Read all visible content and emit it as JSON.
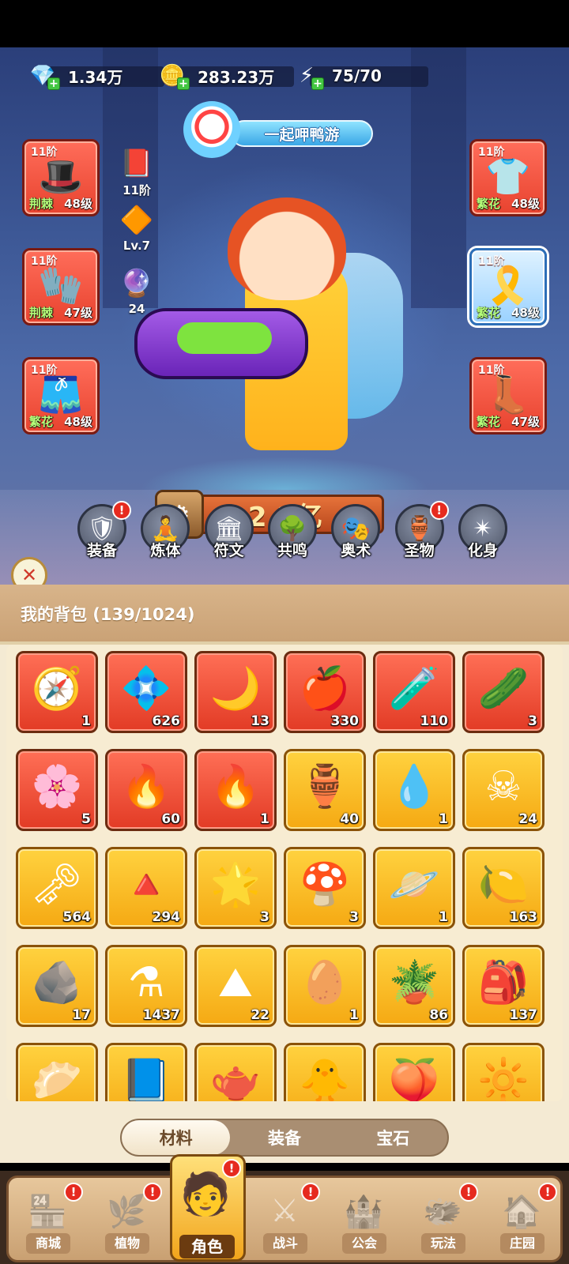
{
  "resources": [
    {
      "icon": "💎",
      "value": "1.34万",
      "name": "diamond"
    },
    {
      "icon": "🪙",
      "value": "283.23万",
      "name": "gold-coin"
    },
    {
      "icon": "⚡",
      "value": "75/70",
      "name": "stamina"
    }
  ],
  "event_banner": {
    "label": "一起呷鸭游"
  },
  "equipment_left": [
    {
      "tier": "11阶",
      "set": "荆棘",
      "level": "48级",
      "icon": "🎩"
    },
    {
      "tier": "11阶",
      "set": "荆棘",
      "level": "47级",
      "icon": "🧤"
    },
    {
      "tier": "11阶",
      "set": "繁花",
      "level": "48级",
      "icon": "🩳"
    }
  ],
  "equipment_right": [
    {
      "tier": "11阶",
      "set": "繁花",
      "level": "48级",
      "icon": "👕"
    },
    {
      "tier": "11阶",
      "set": "繁花",
      "level": "48级",
      "icon": "🎗️"
    },
    {
      "tier": "11阶",
      "set": "繁花",
      "level": "47级",
      "icon": "👢"
    }
  ],
  "mini_stats": [
    {
      "icon": "📕",
      "text": "11阶"
    },
    {
      "icon": "🔶",
      "text": "Lv.7"
    },
    {
      "icon": "🔮",
      "text": "24"
    }
  ],
  "power": {
    "value": "2.2亿",
    "help": "?"
  },
  "functions": [
    {
      "label": "装备",
      "icon": "🛡",
      "alert": "!"
    },
    {
      "label": "炼体",
      "icon": "🧘",
      "alert": ""
    },
    {
      "label": "符文",
      "icon": "🏛",
      "alert": ""
    },
    {
      "label": "共鸣",
      "icon": "🌳",
      "alert": ""
    },
    {
      "label": "奥术",
      "icon": "🎭",
      "alert": ""
    },
    {
      "label": "圣物",
      "icon": "🏺",
      "alert": "!"
    },
    {
      "label": "化身",
      "icon": "✴",
      "alert": ""
    }
  ],
  "bag": {
    "title": "我的背包 (139/1024)",
    "items": [
      {
        "icon": "🧭",
        "qty": "1",
        "rarity": "red"
      },
      {
        "icon": "💠",
        "qty": "626",
        "rarity": "red"
      },
      {
        "icon": "🌙",
        "qty": "13",
        "rarity": "red"
      },
      {
        "icon": "🍎",
        "qty": "330",
        "rarity": "red"
      },
      {
        "icon": "🧪",
        "qty": "110",
        "rarity": "red"
      },
      {
        "icon": "🥒",
        "qty": "3",
        "rarity": "red"
      },
      {
        "icon": "🌸",
        "qty": "5",
        "rarity": "red"
      },
      {
        "icon": "🔥",
        "qty": "60",
        "rarity": "red"
      },
      {
        "icon": "🔥",
        "qty": "1",
        "rarity": "red"
      },
      {
        "icon": "🏺",
        "qty": "40",
        "rarity": "gold"
      },
      {
        "icon": "💧",
        "qty": "1",
        "rarity": "gold"
      },
      {
        "icon": "☠",
        "qty": "24",
        "rarity": "gold"
      },
      {
        "icon": "🗝",
        "qty": "564",
        "rarity": "gold"
      },
      {
        "icon": "🔺",
        "qty": "294",
        "rarity": "gold"
      },
      {
        "icon": "🌟",
        "qty": "3",
        "rarity": "gold"
      },
      {
        "icon": "🍄",
        "qty": "3",
        "rarity": "gold"
      },
      {
        "icon": "🪐",
        "qty": "1",
        "rarity": "gold"
      },
      {
        "icon": "🍋",
        "qty": "163",
        "rarity": "gold"
      },
      {
        "icon": "🪨",
        "qty": "17",
        "rarity": "gold"
      },
      {
        "icon": "⚗",
        "qty": "1437",
        "rarity": "gold"
      },
      {
        "icon": "⛰",
        "qty": "22",
        "rarity": "gold"
      },
      {
        "icon": "🥚",
        "qty": "1",
        "rarity": "gold"
      },
      {
        "icon": "🪴",
        "qty": "86",
        "rarity": "gold"
      },
      {
        "icon": "🎒",
        "qty": "137",
        "rarity": "gold"
      },
      {
        "icon": "🥟",
        "qty": "",
        "rarity": "gold"
      },
      {
        "icon": "📘",
        "qty": "",
        "rarity": "gold"
      },
      {
        "icon": "🫖",
        "qty": "",
        "rarity": "gold"
      },
      {
        "icon": "🐥",
        "qty": "",
        "rarity": "gold"
      },
      {
        "icon": "🍑",
        "qty": "",
        "rarity": "gold"
      },
      {
        "icon": "🔆",
        "qty": "",
        "rarity": "gold"
      }
    ]
  },
  "bag_tabs": [
    {
      "label": "材料",
      "active": true
    },
    {
      "label": "装备",
      "active": false
    },
    {
      "label": "宝石",
      "active": false
    }
  ],
  "nav": [
    {
      "label": "商城",
      "icon": "🏪",
      "alert": "!",
      "active": false
    },
    {
      "label": "植物",
      "icon": "🌿",
      "alert": "!",
      "active": false
    },
    {
      "label": "角色",
      "icon": "🧑",
      "alert": "!",
      "active": true
    },
    {
      "label": "战斗",
      "icon": "⚔",
      "alert": "!",
      "active": false
    },
    {
      "label": "公会",
      "icon": "🏰",
      "alert": "",
      "active": false
    },
    {
      "label": "玩法",
      "icon": "🐲",
      "alert": "!",
      "active": false
    },
    {
      "label": "庄园",
      "icon": "🏠",
      "alert": "!",
      "active": false
    }
  ],
  "colors": {
    "rarity_red": "#e8432f",
    "rarity_gold": "#f5a913",
    "set_green": "#b6ff7a",
    "alert_red": "#e62a1f"
  }
}
